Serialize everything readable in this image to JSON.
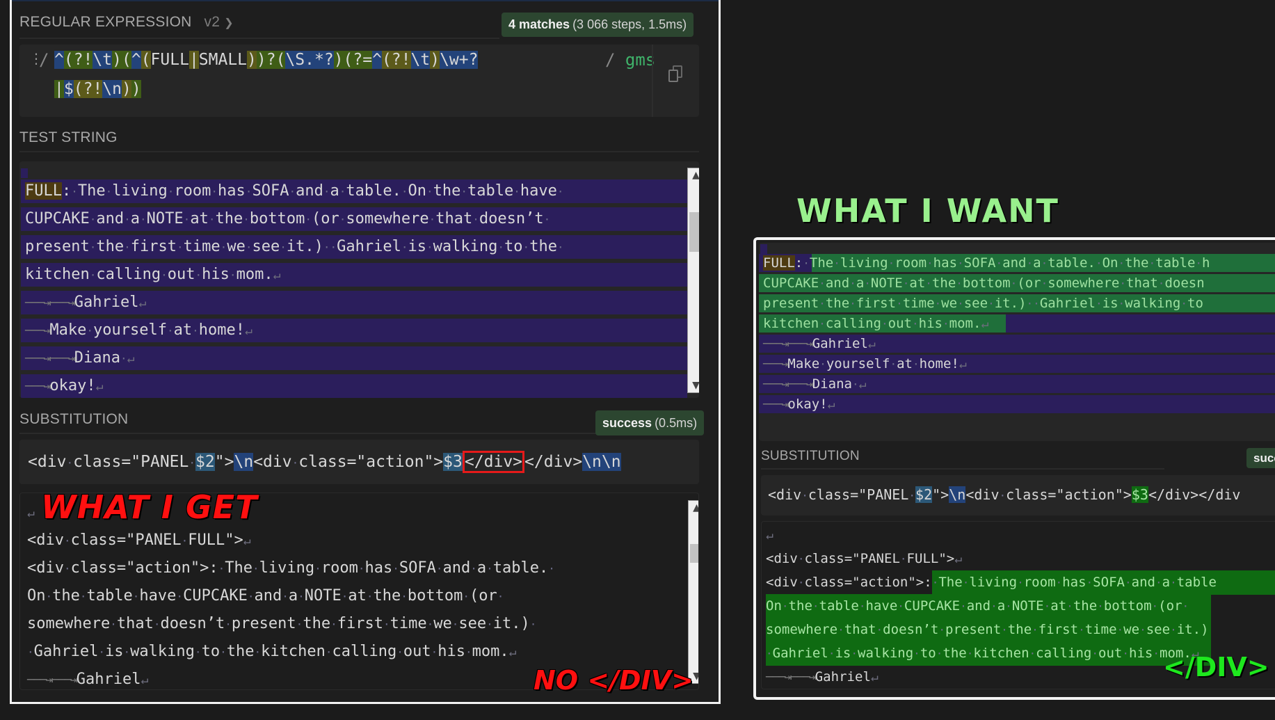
{
  "regex": {
    "label": "REGULAR EXPRESSION",
    "version": "v2",
    "matches_strong": "4 matches",
    "matches_detail": "(3 066 steps, 1.5ms)",
    "delimiter_open": "/",
    "delimiter_close": "/",
    "flags": "gms",
    "tokens_line1": [
      {
        "t": "^",
        "c": "blue"
      },
      {
        "t": "(?!",
        "c": "green"
      },
      {
        "t": "\\t",
        "c": "blue"
      },
      {
        "t": ")",
        "c": "green"
      },
      {
        "t": "(",
        "c": "green"
      },
      {
        "t": "^",
        "c": "blue"
      },
      {
        "t": "(",
        "c": "olive"
      },
      {
        "t": "FULL",
        "c": ""
      },
      {
        "t": "|",
        "c": "olive"
      },
      {
        "t": "SMALL",
        "c": ""
      },
      {
        "t": ")",
        "c": "olive"
      },
      {
        "t": ")?(",
        "c": "green"
      },
      {
        "t": "\\S.*?",
        "c": "blue"
      },
      {
        "t": ")(?=",
        "c": "green"
      },
      {
        "t": "^",
        "c": "blue"
      },
      {
        "t": "(?!",
        "c": "olive"
      },
      {
        "t": "\\t",
        "c": "blue"
      },
      {
        "t": ")",
        "c": "olive"
      },
      {
        "t": "\\w+?",
        "c": "blue"
      }
    ],
    "tokens_line2": [
      {
        "t": "|",
        "c": "green"
      },
      {
        "t": "$",
        "c": "blue"
      },
      {
        "t": "(?!",
        "c": "olive"
      },
      {
        "t": "\\n",
        "c": "blue"
      },
      {
        "t": ")",
        "c": "olive"
      },
      {
        "t": ")",
        "c": "green"
      }
    ]
  },
  "test_string": {
    "label": "TEST STRING",
    "lines": [
      "FULL: The living room has SOFA and a table. On the table have ",
      "CUPCAKE and a NOTE at the bottom (or somewhere that doesn’t ",
      "present the first time we see it.)  Gahriel is walking to the ",
      "kitchen calling out his mom.",
      "\t\tGahriel",
      "\tMake yourself at home!",
      "\t\tDiana ",
      "\tokay!"
    ]
  },
  "substitution": {
    "label": "SUBSTITUTION",
    "status_strong": "success",
    "status_detail": "(0.5ms)",
    "template_parts": [
      {
        "t": "<div class=\"PANEL ",
        "c": ""
      },
      {
        "t": "$2",
        "c": "teal"
      },
      {
        "t": "\">",
        "c": ""
      },
      {
        "t": "\\n",
        "c": "blue"
      },
      {
        "t": "<div class=\"action\">",
        "c": ""
      },
      {
        "t": "$3",
        "c": "teal"
      },
      {
        "t": "</div>",
        "c": "boxed"
      },
      {
        "t": "</div>",
        "c": ""
      },
      {
        "t": "\\n\\n",
        "c": "blue"
      }
    ],
    "output_lines": [
      "",
      "<div class=\"PANEL FULL\">",
      "<div class=\"action\">: The living room has SOFA and a table. ",
      "On the table have CUPCAKE and a NOTE at the bottom (or ",
      "somewhere that doesn’t present the first time we see it.) ",
      " Gahriel is walking to the kitchen calling out his mom.",
      "\t\tGahriel"
    ]
  },
  "annotations": {
    "what_i_get": "WHAT I GET",
    "no_div": "NO </DIV>",
    "what_i_want": "WHAT I WANT",
    "div": "</DIV>"
  },
  "right_panel": {
    "test_lines": [
      "FULL: The living room has SOFA and a table. On the table h",
      "CUPCAKE and a NOTE at the bottom (or somewhere that doesn",
      "present the first time we see it.)  Gahriel is walking to",
      "kitchen calling out his mom.",
      "\t\tGahriel",
      "\tMake yourself at home!",
      "\t\tDiana ",
      "\tokay!"
    ],
    "sub_label": "SUBSTITUTION",
    "sub_status": "succ",
    "template_parts": [
      {
        "t": "<div class=\"PANEL ",
        "c": ""
      },
      {
        "t": "$2",
        "c": "teal"
      },
      {
        "t": "\">",
        "c": ""
      },
      {
        "t": "\\n",
        "c": "blue"
      },
      {
        "t": "<div class=\"action\">",
        "c": ""
      },
      {
        "t": "$3",
        "c": "subgreen"
      },
      {
        "t": "</div></div",
        "c": ""
      }
    ],
    "output_lines": [
      "",
      "<div class=\"PANEL FULL\">",
      "<div class=\"action\">: The living room has SOFA and a table",
      "On the table have CUPCAKE and a NOTE at the bottom (or ",
      "somewhere that doesn’t present the first time we see it.)",
      " Gahriel is walking to the kitchen calling out his mom.",
      "\t\tGahriel"
    ]
  }
}
